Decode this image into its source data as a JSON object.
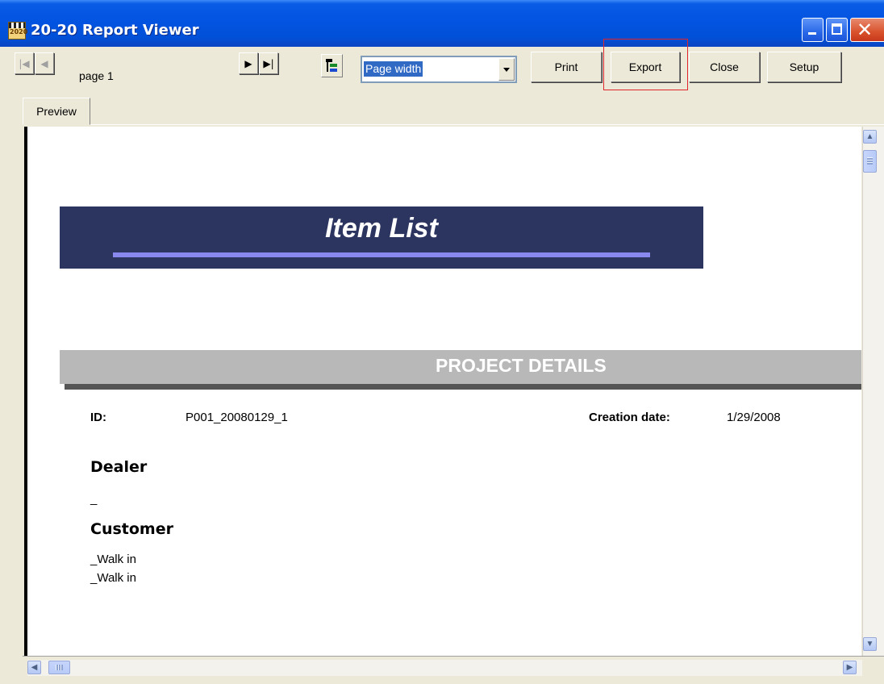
{
  "window": {
    "title": "20-20 Report Viewer",
    "app_icon": "2020-clapper-icon"
  },
  "toolbar": {
    "page_label": "page 1",
    "zoom": {
      "selected": "Page width"
    },
    "buttons": {
      "print": "Print",
      "export": "Export",
      "close": "Close",
      "setup": "Setup"
    },
    "nav_icons": [
      "first-page-icon",
      "previous-page-icon",
      "next-page-icon",
      "last-page-icon"
    ],
    "highlight_color": "#e0262d"
  },
  "tabs": [
    {
      "label": "Preview",
      "active": true
    }
  ],
  "report": {
    "title": "Item List",
    "banner_color": "#2c3460",
    "section_header": "PROJECT DETAILS",
    "fields": {
      "id_label": "ID:",
      "id_value": "P001_20080129_1",
      "creation_date_label": "Creation date:",
      "creation_date_value": "1/29/2008"
    },
    "dealer": {
      "heading": "Dealer",
      "value": "_"
    },
    "customer": {
      "heading": "Customer",
      "lines": [
        "_Walk in",
        "_Walk in"
      ]
    }
  }
}
